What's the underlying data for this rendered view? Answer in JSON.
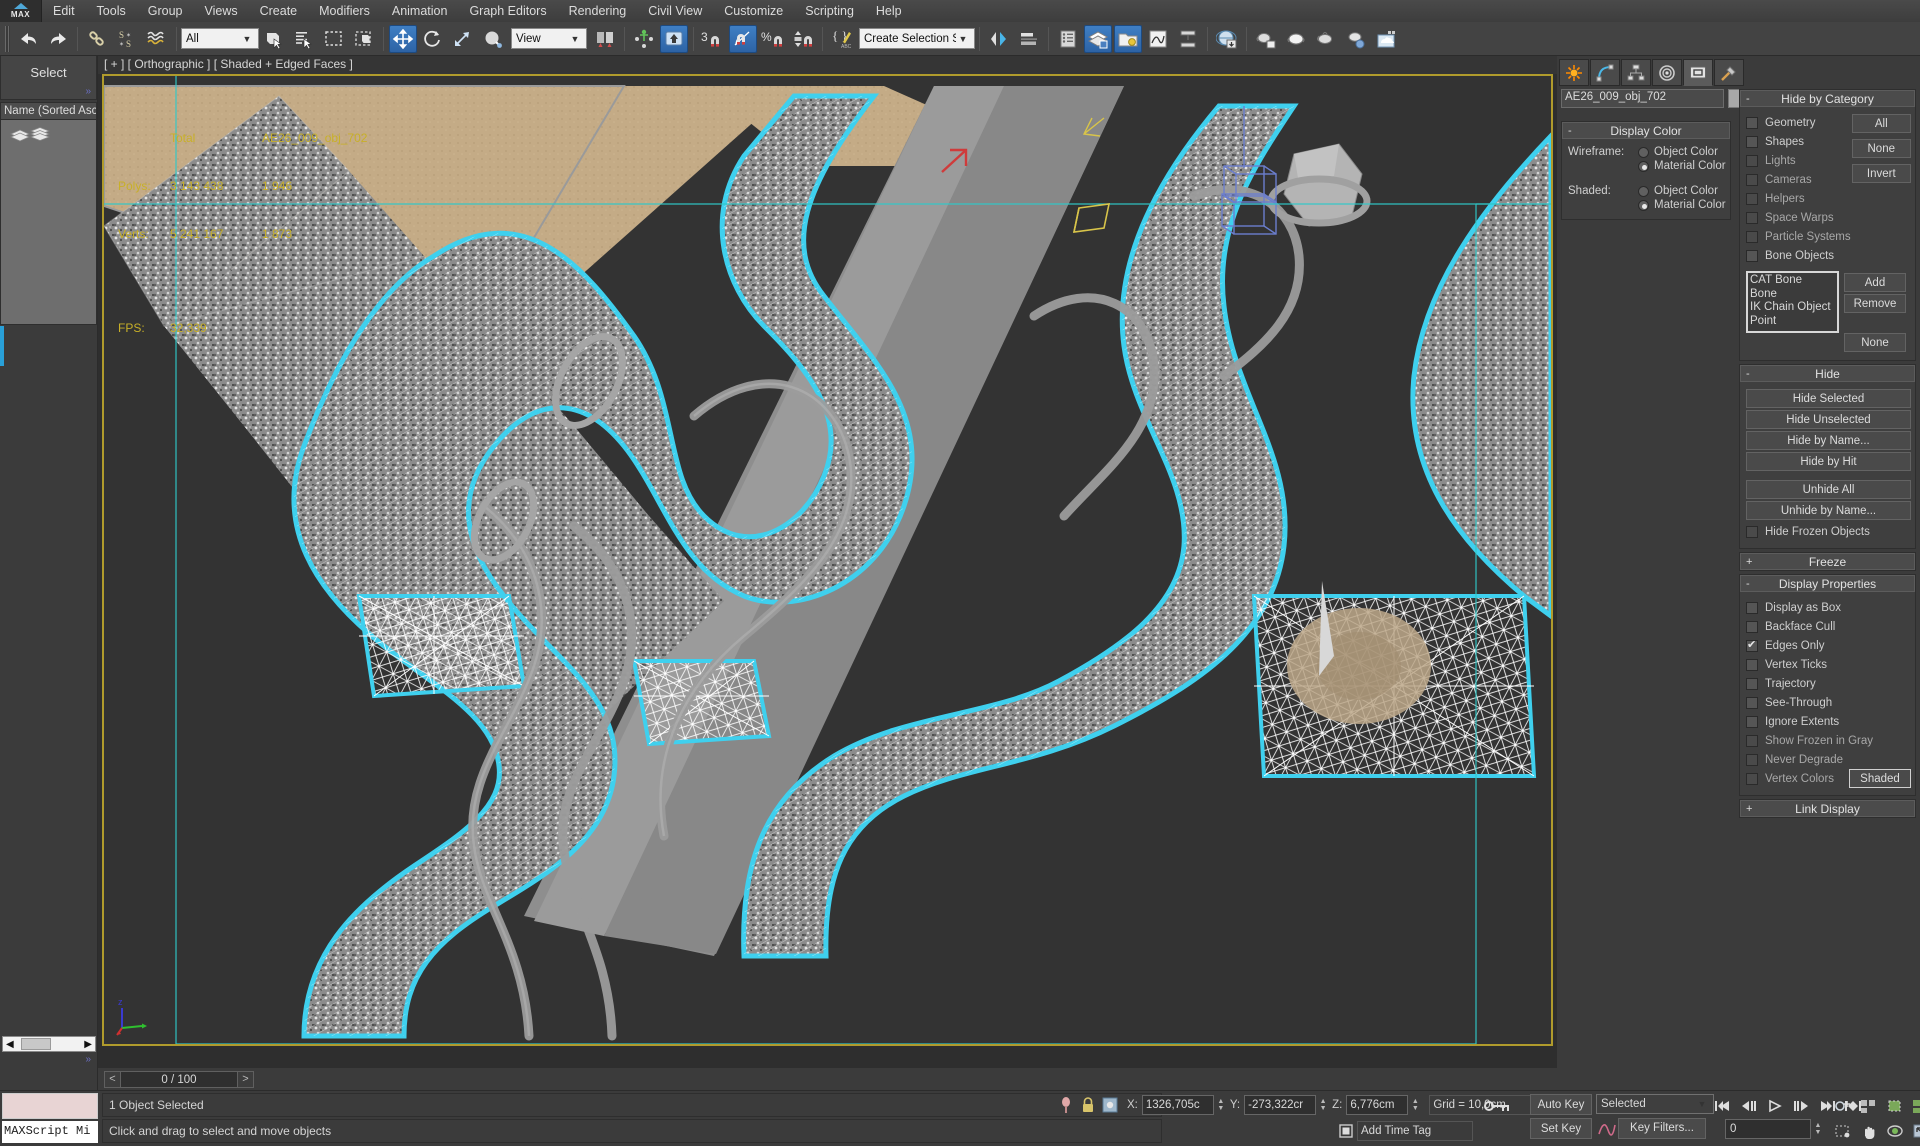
{
  "app": {
    "logo_text": "MAX"
  },
  "menu": {
    "items": [
      {
        "label": "Edit"
      },
      {
        "label": "Tools"
      },
      {
        "label": "Group"
      },
      {
        "label": "Views"
      },
      {
        "label": "Create"
      },
      {
        "label": "Modifiers"
      },
      {
        "label": "Animation"
      },
      {
        "label": "Graph Editors"
      },
      {
        "label": "Rendering"
      },
      {
        "label": "Civil View"
      },
      {
        "label": "Customize"
      },
      {
        "label": "Scripting"
      },
      {
        "label": "Help"
      }
    ]
  },
  "toolbar": {
    "selection_filter_value": "All",
    "ref_coord_value": "View",
    "named_selection_value": "Create Selection Se",
    "snap_percent_label": "%",
    "snap_3_label": "3",
    "icons": [
      "undo-icon",
      "redo-icon",
      "select-link-icon",
      "unlink-icon",
      "bind-spacewarp-icon",
      "select-object-icon",
      "select-by-name-icon",
      "rect-select-region-icon",
      "window-crossing-icon",
      "select-move-icon",
      "select-rotate-icon",
      "select-scale-icon",
      "select-place-icon",
      "mirror-icon",
      "align-icon",
      "layer-explorer-icon",
      "curve-editor-icon",
      "schematic-view-icon",
      "material-editor-icon",
      "render-setup-icon",
      "render-frame-window-icon",
      "render-production-icon"
    ]
  },
  "left_panel": {
    "title": "Select",
    "list_header": "Name (Sorted Asc",
    "expand_chevron": "»"
  },
  "viewport": {
    "label": "[ + ] [ Orthographic ] [ Shaded + Edged Faces ]",
    "stats": {
      "header_total": "Total",
      "header_object": "AE26_009_obj_702",
      "polys_label": "Polys:",
      "polys_total": "3 143 438",
      "polys_object": "1 946",
      "verts_label": "Verts:",
      "verts_total": "5 241 167",
      "verts_object": "1 873",
      "fps_label": "FPS:",
      "fps_value": "32,339"
    },
    "axis": {
      "z": "z"
    }
  },
  "timeline": {
    "prev": "<",
    "next": ">",
    "frame_label": "0 / 100"
  },
  "command_panel": {
    "tabs": [
      {
        "name": "create-tab",
        "icon": "star-icon",
        "active": false
      },
      {
        "name": "modify-tab",
        "icon": "bend-curve-icon",
        "active": false
      },
      {
        "name": "hierarchy-tab",
        "icon": "hierarchy-icon",
        "active": false
      },
      {
        "name": "motion-tab",
        "icon": "motion-wheel-icon",
        "active": false
      },
      {
        "name": "display-tab",
        "icon": "monitor-icon",
        "active": true
      },
      {
        "name": "utilities-tab",
        "icon": "hammer-icon",
        "active": false
      }
    ],
    "object_name": "AE26_009_obj_702",
    "display_color": {
      "title": "Display Color",
      "wireframe_label": "Wireframe:",
      "shaded_label": "Shaded:",
      "wireframe_object_color": "Object Color",
      "wireframe_material_color": "Material Color",
      "shaded_object_color": "Object Color",
      "shaded_material_color": "Material Color",
      "wireframe_selected": "Material Color",
      "shaded_selected": "Material Color"
    },
    "hide_by_category": {
      "title": "Hide by Category",
      "categories": [
        {
          "label": "Geometry",
          "checked": false,
          "dim": false
        },
        {
          "label": "Shapes",
          "checked": false,
          "dim": false
        },
        {
          "label": "Lights",
          "checked": false,
          "dim": true
        },
        {
          "label": "Cameras",
          "checked": false,
          "dim": true
        },
        {
          "label": "Helpers",
          "checked": false,
          "dim": true
        },
        {
          "label": "Space Warps",
          "checked": false,
          "dim": true
        },
        {
          "label": "Particle Systems",
          "checked": false,
          "dim": true
        },
        {
          "label": "Bone Objects",
          "checked": false,
          "dim": false
        }
      ],
      "buttons": [
        "All",
        "None",
        "Invert"
      ],
      "list_items": [
        "CAT Bone",
        "Bone",
        "IK Chain Object",
        "Point"
      ],
      "side_buttons": [
        "Add",
        "Remove",
        "None"
      ]
    },
    "hide": {
      "title": "Hide",
      "buttons": [
        "Hide Selected",
        "Hide Unselected",
        "Hide by Name...",
        "Hide by Hit",
        "Unhide All",
        "Unhide by Name..."
      ],
      "hide_frozen_label": "Hide Frozen Objects",
      "hide_frozen_checked": false
    },
    "freeze": {
      "title": "Freeze",
      "expanded": false
    },
    "display_properties": {
      "title": "Display Properties",
      "items": [
        {
          "label": "Display as Box",
          "checked": false,
          "dim": false
        },
        {
          "label": "Backface Cull",
          "checked": false,
          "dim": false
        },
        {
          "label": "Edges Only",
          "checked": true,
          "dim": false
        },
        {
          "label": "Vertex Ticks",
          "checked": false,
          "dim": false
        },
        {
          "label": "Trajectory",
          "checked": false,
          "dim": false
        },
        {
          "label": "See-Through",
          "checked": false,
          "dim": false
        },
        {
          "label": "Ignore Extents",
          "checked": false,
          "dim": false
        },
        {
          "label": "Show Frozen in Gray",
          "checked": false,
          "dim": true
        },
        {
          "label": "Never Degrade",
          "checked": false,
          "dim": true
        },
        {
          "label": "Vertex Colors",
          "checked": false,
          "dim": true
        }
      ],
      "shaded_button": "Shaded"
    },
    "link_display": {
      "title": "Link Display",
      "expanded": false
    }
  },
  "status_bar": {
    "maxscript_label": "MAXScript Mi",
    "selection_status": "1 Object Selected",
    "prompt": "Click and drag to select and move objects",
    "coords": {
      "x_label": "X:",
      "x_value": "1326,705c",
      "y_label": "Y:",
      "y_value": "-273,322cr",
      "z_label": "Z:",
      "z_value": "6,776cm"
    },
    "grid_text": "Grid = 10,0cm",
    "add_time_tag": "Add Time Tag",
    "auto_key": "Auto Key",
    "set_key": "Set Key",
    "key_filters": "Key Filters...",
    "key_mode_value": "Selected",
    "current_frame": "0"
  },
  "colors": {
    "accent_blue": "#2d63a5",
    "selection_cyan": "#3fd0ee",
    "viewport_border": "#b09b2c",
    "stats_yellow": "#c8b028",
    "panel_bg": "#3b3b3b"
  }
}
